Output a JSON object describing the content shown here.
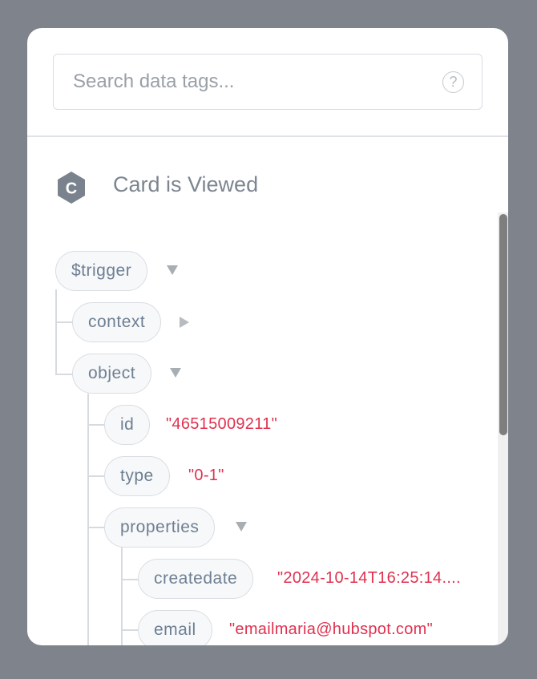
{
  "search": {
    "placeholder": "Search data tags...",
    "help_icon": "?"
  },
  "event": {
    "badge_letter": "C",
    "title": "Card is Viewed"
  },
  "tree": {
    "trigger": {
      "key": "$trigger",
      "expanded": true
    },
    "context": {
      "key": "context",
      "expanded": false
    },
    "object": {
      "key": "object",
      "expanded": true
    },
    "id": {
      "key": "id",
      "value": "\"46515009211\""
    },
    "type": {
      "key": "type",
      "value": "\"0-1\""
    },
    "properties": {
      "key": "properties",
      "expanded": true
    },
    "createdate": {
      "key": "createdate",
      "value": "\"2024-10-14T16:25:14...."
    },
    "email": {
      "key": "email",
      "value": "\"emailmaria@hubspot.com\""
    }
  },
  "colors": {
    "value_text": "#e0314f",
    "key_text": "#6d7f93",
    "backdrop": "#7f848c"
  }
}
